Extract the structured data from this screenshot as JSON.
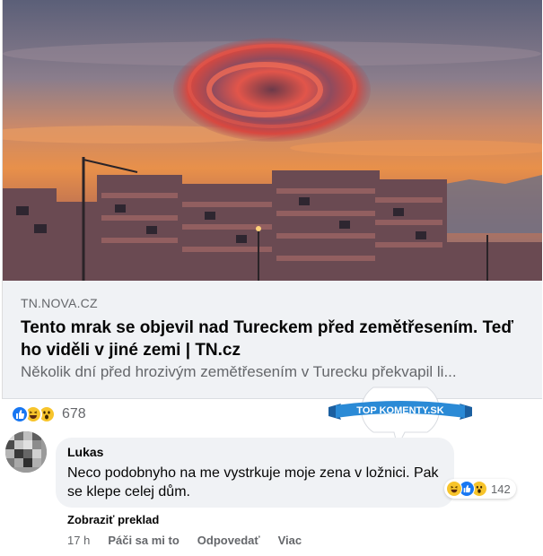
{
  "link_preview": {
    "domain": "TN.NOVA.CZ",
    "headline": "Tento mrak se objevil nad Tureckem před zemětřesením. Teď ho viděli v jiné zemi | TN.cz",
    "description": "Několik dní před hrozivým zemětřesením v Turecku překvapil li..."
  },
  "reactions": {
    "icons": [
      "like-icon",
      "haha-icon",
      "wow-icon"
    ],
    "count": "678"
  },
  "badge": {
    "text": "TOP KOMENTY.SK"
  },
  "comment": {
    "author": "Lukas",
    "text": "Neco podobnyho na me vystrkuje moje zena v ložnici. Pak se klepe celej dům.",
    "reaction_icons": [
      "haha-icon",
      "like-icon",
      "wow-icon"
    ],
    "reaction_count": "142",
    "translate_label": "Zobraziť preklad",
    "time": "17 h",
    "like_label": "Páči sa mi to",
    "reply_label": "Odpovedať",
    "more_label": "Viac"
  },
  "colors": {
    "like_blue": "#1877f2",
    "emoji_yellow": "#f7c42b",
    "badge_blue": "#2a8ad6",
    "muted_text": "#65676b",
    "card_bg": "#f0f2f5"
  }
}
